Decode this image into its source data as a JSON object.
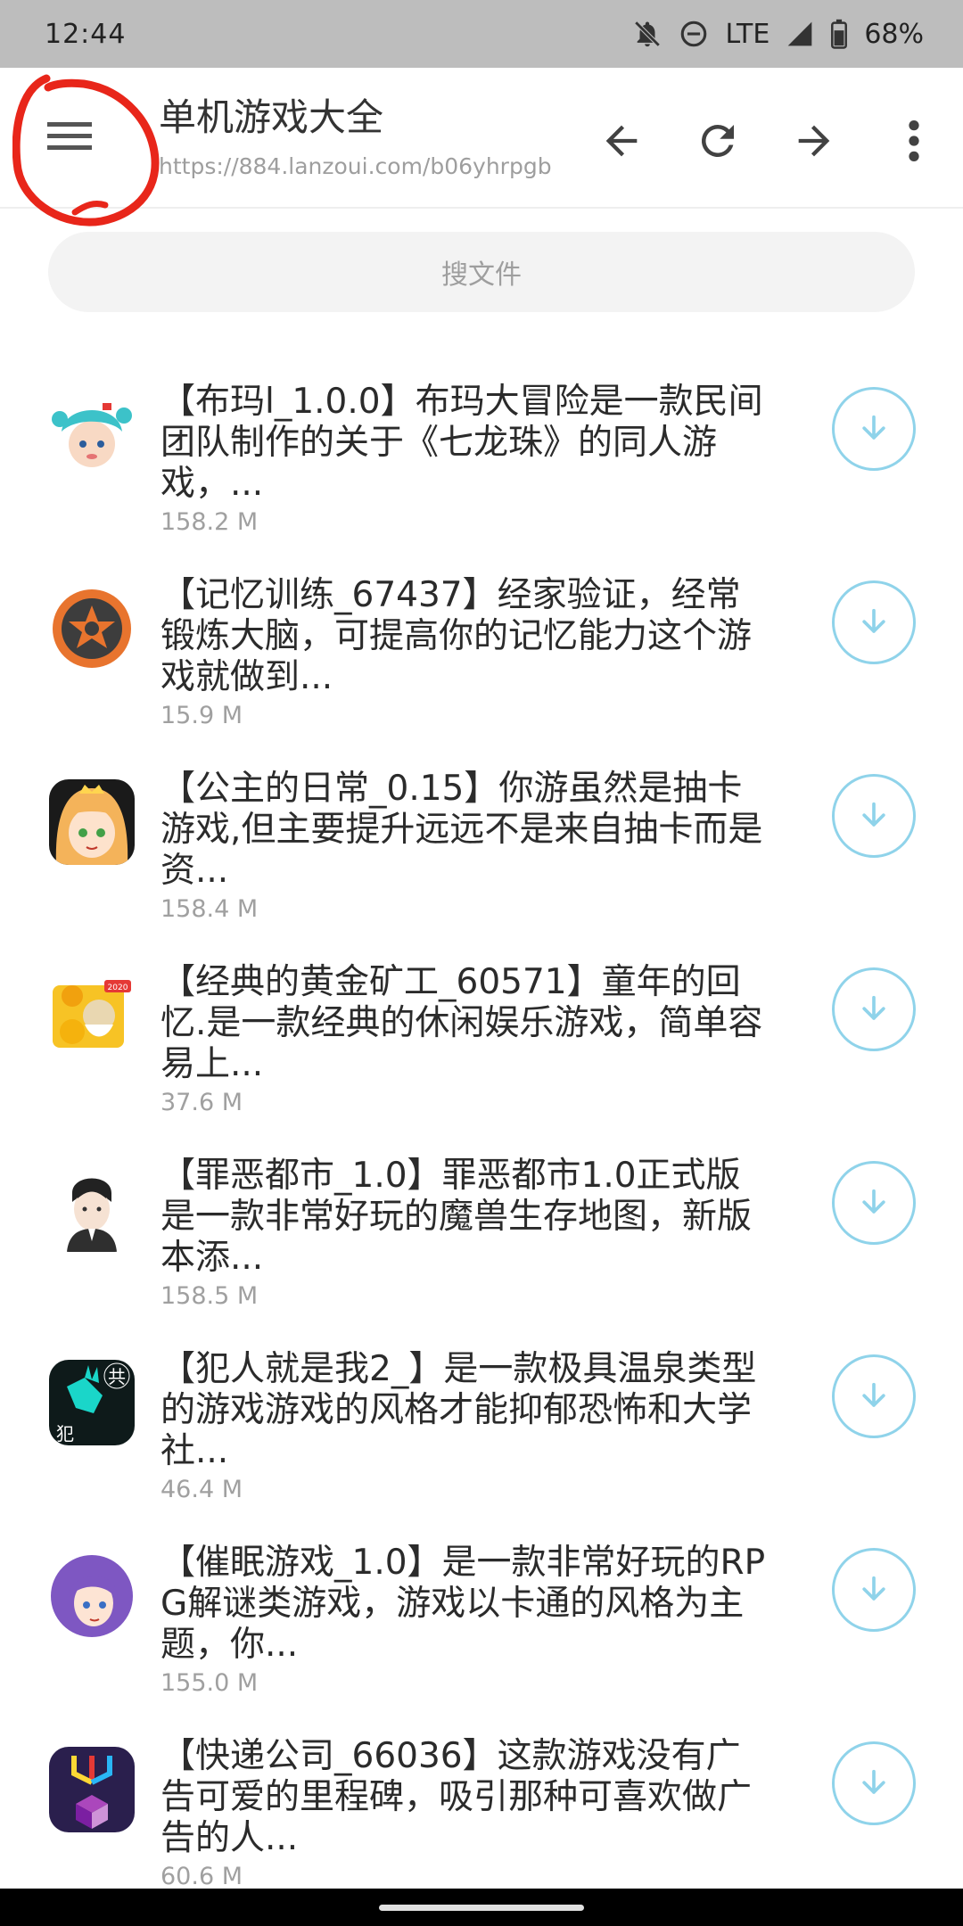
{
  "status_bar": {
    "time": "12:44",
    "network": "LTE",
    "battery": "68%",
    "icons": [
      "bell-off-icon",
      "do-not-disturb-icon",
      "signal-icon",
      "battery-icon"
    ]
  },
  "app_bar": {
    "title": "单机游戏大全",
    "url": "https://884.lanzoui.com/b06yhrpgb",
    "icons": [
      "menu-icon",
      "back-arrow-icon",
      "refresh-icon",
      "forward-arrow-icon",
      "more-vertical-icon"
    ]
  },
  "search": {
    "placeholder": "搜文件"
  },
  "files": [
    {
      "desc": "【布玛l_1.0.0】布玛大冒险是一款民间团队制作的关于《七龙珠》的同人游戏，...",
      "size": "158.2 M"
    },
    {
      "desc": "【记忆训练_67437】经家验证，经常锻炼大脑，可提高你的记忆能力这个游戏就做到...",
      "size": "15.9 M"
    },
    {
      "desc": "【公主的日常_0.15】你游虽然是抽卡游戏,但主要提升远远不是来自抽卡而是资...",
      "size": "158.4 M"
    },
    {
      "desc": "【经典的黄金矿工_60571】童年的回忆.是一款经典的休闲娱乐游戏，简单容易上...",
      "size": "37.6 M"
    },
    {
      "desc": "【罪恶都市_1.0】罪恶都市1.0正式版是一款非常好玩的魔兽生存地图，新版本添...",
      "size": "158.5 M"
    },
    {
      "desc": "【犯人就是我2_】是一款极具温泉类型的游戏游戏的风格才能抑郁恐怖和大学社...",
      "size": "46.4 M"
    },
    {
      "desc": "【催眠游戏_1.0】是一款非常好玩的RPG解谜类游戏，游戏以卡通的风格为主题，你...",
      "size": "155.0 M"
    },
    {
      "desc": "【快递公司_66036】这款游戏没有广告可爱的里程碑，吸引那种可喜欢做广告的人...",
      "size": "60.6 M"
    }
  ],
  "icon_badges": {
    "game4_badge": "2020",
    "game6_top": "共",
    "game6_bottom": "犯"
  },
  "colors": {
    "accent": "#8fd3ea",
    "annotation": "#e8261a",
    "status_bar": "#bdbdbd"
  }
}
